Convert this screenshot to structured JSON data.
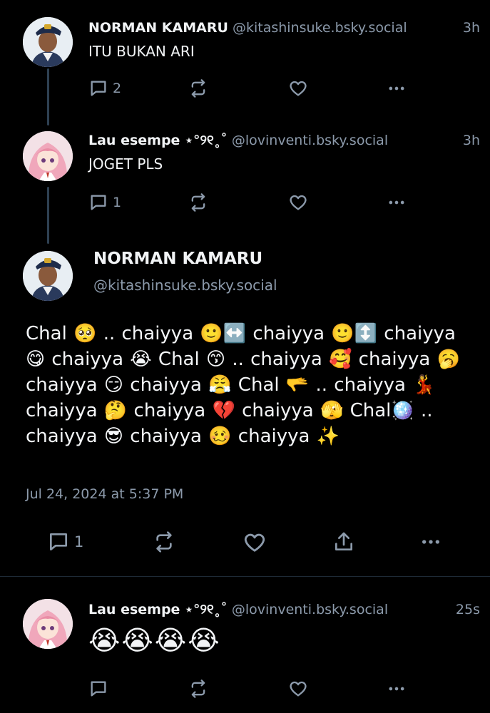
{
  "posts": [
    {
      "name": "NORMAN KAMARU",
      "handle": "@kitashinsuke.bsky.social",
      "time": "3h",
      "text": "ITU BUKAN ARI",
      "replies": "2",
      "avatar_icon": "man-avatar-icon"
    },
    {
      "name": "Lau esempe ⋆°୨୧˳˚",
      "handle": "@lovinventi.bsky.social",
      "time": "3h",
      "text": "JOGET PLS",
      "replies": "1",
      "avatar_icon": "anime-girl-avatar-icon"
    }
  ],
  "main_post": {
    "name": "NORMAN KAMARU",
    "handle": "@kitashinsuke.bsky.social",
    "text": "Chal 🥺 .. chaiyya 🙂↔️ chaiyya 🙂↕️ chaiyya 😋 chaiyya 😭  Chal 😙 .. chaiyya 🥰 chaiyya 🥱 chaiyya 😏 chaiyya 😤 Chal 🫳 .. chaiyya 💃 chaiyya 🤔 chaiyya 💔 chaiyya 🫣 Chal🪩 .. chaiyya 😎 chaiyya 🥴  chaiyya ✨",
    "date": "Jul 24, 2024 at 5:37 PM",
    "replies": "1"
  },
  "reply_post": {
    "name": "Lau esempe ⋆°୨୧˳˚",
    "handle": "@lovinventi.bsky.social",
    "time": "25s",
    "text": "😭😭😭😭"
  },
  "colors": {
    "background": "#000000",
    "text": "#f1f3f5",
    "muted": "#8c9aab",
    "thread_line": "#2e4052"
  }
}
